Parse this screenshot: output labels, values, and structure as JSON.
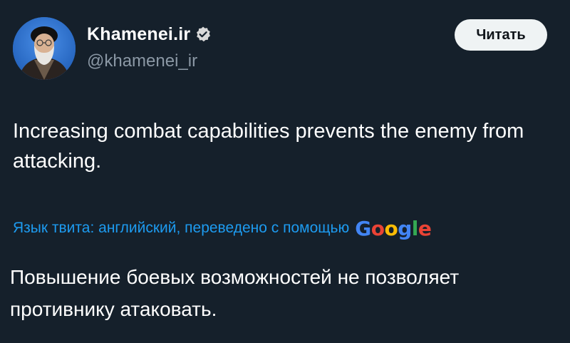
{
  "author": {
    "display_name": "Khamenei.ir",
    "handle": "@khamenei_ir",
    "verified": true,
    "avatar_icon": "portrait-avatar"
  },
  "actions": {
    "read_label": "Читать"
  },
  "tweet": {
    "text": "Increasing combat capabilities prevents the enemy from attacking."
  },
  "translation": {
    "note": "Язык твита: английский, переведено с помощью",
    "provider": {
      "letters": [
        "G",
        "o",
        "o",
        "g",
        "l",
        "e"
      ],
      "colors": [
        "#4285f4",
        "#ea4335",
        "#fbbc05",
        "#4285f4",
        "#34a853",
        "#ea4335"
      ]
    },
    "text": "Повышение боевых возможностей не позволяет противнику атаковать."
  },
  "colors": {
    "background": "#15202b",
    "link": "#1d9bf0",
    "secondary_text": "#8b98a5",
    "verified_badge": "#d9d9d9"
  }
}
